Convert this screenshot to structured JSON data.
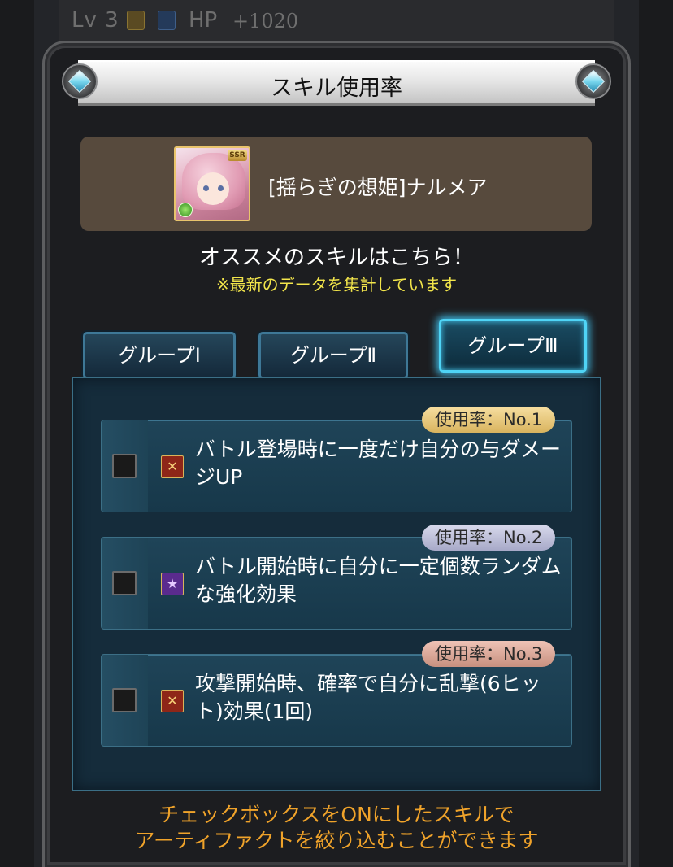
{
  "background": {
    "level": "Lv 3",
    "hp_label": "HP",
    "hp_value": "+1020"
  },
  "dialog": {
    "title": "スキル使用率"
  },
  "character": {
    "name": "[揺らぎの想姫]ナルメア",
    "rarity": "SSR"
  },
  "recommend": "オススメのスキルはこちら！",
  "note": "※最新のデータを集計しています",
  "tabs": [
    {
      "label": "グループⅠ",
      "active": false
    },
    {
      "label": "グループⅡ",
      "active": false
    },
    {
      "label": "グループⅢ",
      "active": true
    }
  ],
  "skills": [
    {
      "rank": "使用率：No.1",
      "icon": "attack-icon",
      "checked": false,
      "description": "バトル登場時に一度だけ自分の与ダメージUP"
    },
    {
      "rank": "使用率：No.2",
      "icon": "buff-star-icon",
      "checked": false,
      "description": "バトル開始時に自分に一定個数ランダムな強化効果"
    },
    {
      "rank": "使用率：No.3",
      "icon": "attack-icon",
      "checked": false,
      "description": "攻撃開始時、確率で自分に乱撃(6ヒット)効果(1回)"
    }
  ],
  "footer": {
    "line1": "チェックボックスをONにしたスキルで",
    "line2": "アーティファクトを絞り込むことができます"
  },
  "colors": {
    "note": "#f2e54b",
    "footer": "#f0a32a",
    "active_tab_glow": "#4fd4f6",
    "rank1": "#e5c271",
    "rank2": "#b9bbd6",
    "rank3": "#d9a596"
  }
}
